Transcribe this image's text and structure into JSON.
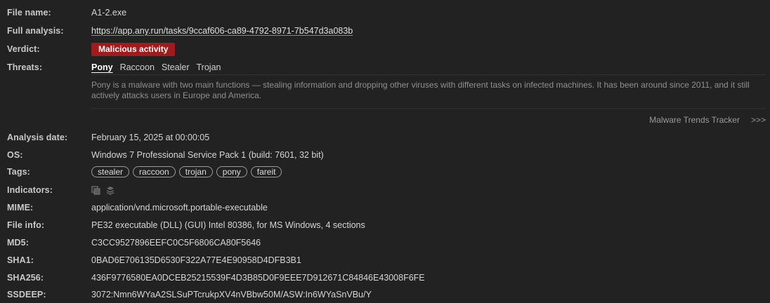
{
  "file_name": {
    "label": "File name:",
    "value": "A1-2.exe"
  },
  "full_analysis": {
    "label": "Full analysis:",
    "url": "https://app.any.run/tasks/9ccaf606-ca89-4792-8971-7b547d3a083b"
  },
  "verdict": {
    "label": "Verdict:",
    "value": "Malicious activity",
    "color": "#a01c1c"
  },
  "threats": {
    "label": "Threats:",
    "items": [
      "Pony",
      "Raccoon",
      "Stealer",
      "Trojan"
    ],
    "active": "Pony",
    "description": "Pony is a malware with two main functions — stealing information and dropping other viruses with different tasks on infected machines. It has been around since 2011, and it still actively attacks users in Europe and America."
  },
  "tracker": {
    "label": "Malware Trends Tracker",
    "arrows": ">>>"
  },
  "analysis_date": {
    "label": "Analysis date:",
    "value": "February 15, 2025 at 00:00:05"
  },
  "os": {
    "label": "OS:",
    "value": "Windows 7 Professional Service Pack 1 (build: 7601, 32 bit)"
  },
  "tags": {
    "label": "Tags:",
    "items": [
      "stealer",
      "raccoon",
      "trojan",
      "pony",
      "fareit"
    ]
  },
  "indicators": {
    "label": "Indicators:",
    "icons": [
      "copy-icon",
      "stacked-layers-icon"
    ]
  },
  "mime": {
    "label": "MIME:",
    "value": "application/vnd.microsoft.portable-executable"
  },
  "file_info": {
    "label": "File info:",
    "value": "PE32 executable (DLL) (GUI) Intel 80386, for MS Windows, 4 sections"
  },
  "md5": {
    "label": "MD5:",
    "value": "C3CC9527896EEFC0C5F6806CA80F5646"
  },
  "sha1": {
    "label": "SHA1:",
    "value": "0BAD6E706135D6530F322A77E4E90958D4DFB3B1"
  },
  "sha256": {
    "label": "SHA256:",
    "value": "436F9776580EA0DCEB25215539F4D3B85D0F9EEE7D912671C84846E43008F6FE"
  },
  "ssdeep": {
    "label": "SSDEEP:",
    "value": "3072:Nmn6WYaA2SLSuPTcrukpXV4nVBbw50M/ASW:In6WYaSnVBu/Y"
  }
}
